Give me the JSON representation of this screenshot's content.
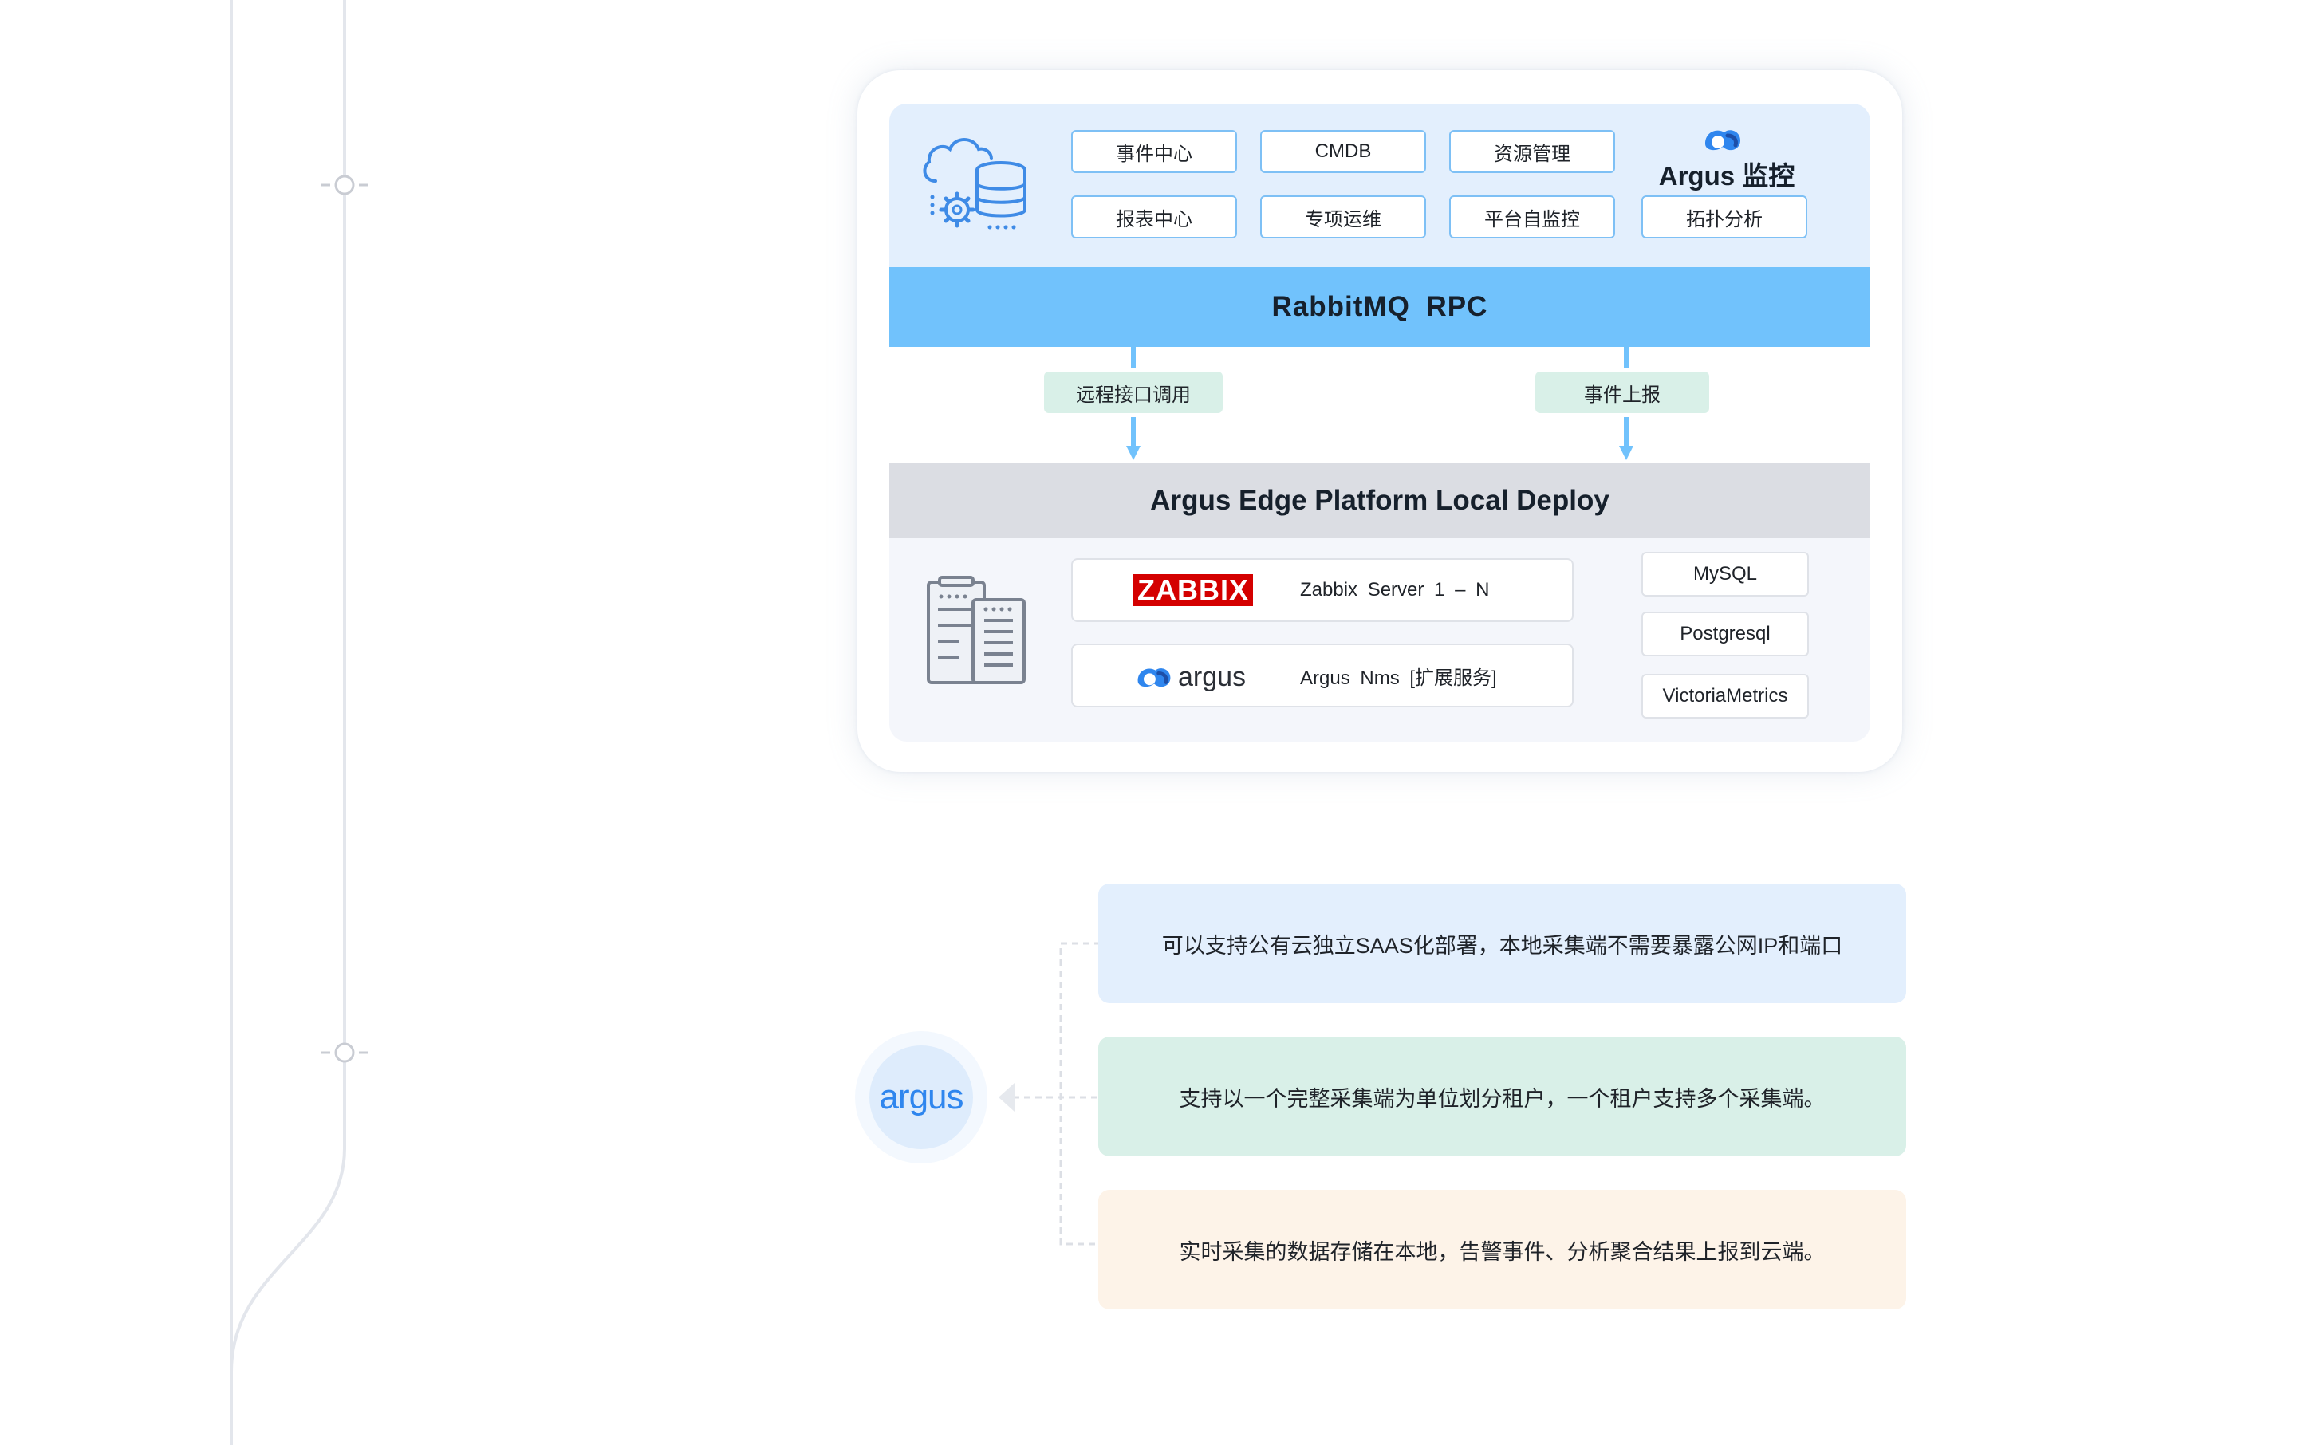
{
  "top_panel": {
    "brand": "Argus 监控",
    "modules": [
      "事件中心",
      "CMDB",
      "资源管理",
      "报表中心",
      "专项运维",
      "平台自监控",
      "拓扑分析"
    ]
  },
  "rabbitmq_bar": "RabbitMQ  RPC",
  "flows": {
    "left": "远程接口调用",
    "right": "事件上报"
  },
  "edge_platform": {
    "title": "Argus Edge Platform Local Deploy",
    "zabbix_logo": "ZABBIX",
    "zabbix_server": "Zabbix  Server 1 – N",
    "argus_logo": "argus",
    "argus_nms": "Argus Nms [扩展服务]",
    "databases": [
      "MySQL",
      "Postgresql",
      "VictoriaMetrics"
    ]
  },
  "features": {
    "logo": "argus",
    "items": [
      {
        "text": "可以支持公有云独立SAAS化部署，本地采集端不需要暴露公网IP和端口",
        "color": "#e3effd"
      },
      {
        "text": "支持以一个完整采集端为单位划分租户，一个租户支持多个采集端。",
        "color": "#d9f0e8"
      },
      {
        "text": "实时采集的数据存储在本地，告警事件、分析聚合结果上报到云端。",
        "color": "#fdf3e8"
      }
    ]
  },
  "colors": {
    "accent_blue": "#71c2fc",
    "panel_blue": "#e3effd",
    "edge_gray": "#dbdde3",
    "tag_green": "#d9f0e8",
    "zabbix_red": "#d40000",
    "argus_blue": "#2f86ee"
  }
}
